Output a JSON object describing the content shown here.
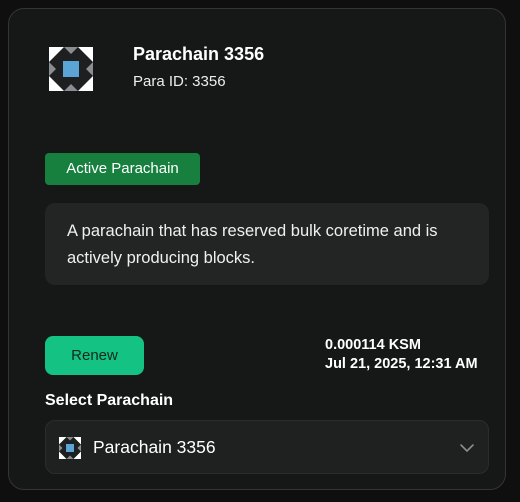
{
  "parachain": {
    "name": "Parachain 3356",
    "para_id_text": "Para ID: 3356"
  },
  "status": {
    "badge_label": "Active Parachain",
    "badge_color": "#17803f",
    "description": "A parachain that has reserved bulk coretime and is actively producing blocks."
  },
  "renewal": {
    "button_label": "Renew",
    "button_color": "#14c384",
    "price": "0.000114 KSM",
    "date": "Jul 21, 2025, 12:31 AM"
  },
  "selector": {
    "label": "Select Parachain",
    "selected_value": "Parachain 3356",
    "icon": "parachain-logo-icon",
    "chevron": "chevron-down-icon"
  }
}
